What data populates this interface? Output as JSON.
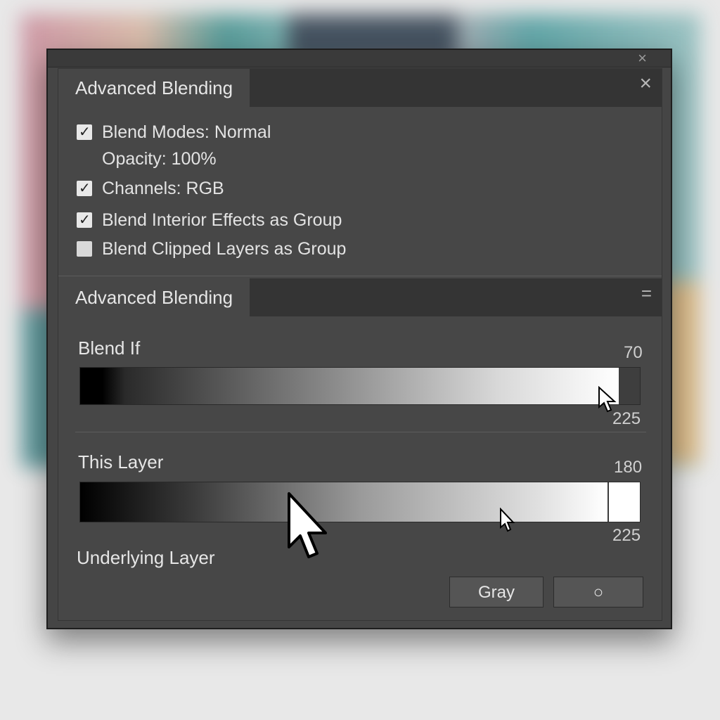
{
  "window": {
    "outer_close_glyph": "×"
  },
  "section1": {
    "tab_label": "Advanced Blending",
    "close_glyph": "×",
    "options": [
      {
        "label": "Blend Modes: Normal",
        "checked": true
      },
      {
        "label": "Opacity: 100%"
      },
      {
        "label": "Channels: RGB",
        "checked": true
      },
      {
        "label": "Blend Interior Effects as Group",
        "checked": true
      },
      {
        "label": "Blend Clipped Layers as Group",
        "checked": false
      }
    ]
  },
  "section2": {
    "tab_label": "Advanced Blending",
    "menu_glyph": "=",
    "blend_if": {
      "label": "Blend If",
      "value_top": "70",
      "value_bottom": "225"
    },
    "this_layer": {
      "label": "This Layer",
      "value_top": "180",
      "value_bottom": "225"
    },
    "underlying_label": "Underlying Layer",
    "buttons": {
      "gray": "Gray",
      "circle": "○"
    }
  },
  "colors": {
    "panel": "#474747",
    "tab_strip": "#343434",
    "text": "#e6e6e6"
  },
  "icons": [
    "close-icon",
    "checkmark-icon",
    "menu-icon",
    "arrow-cursor-icon"
  ]
}
